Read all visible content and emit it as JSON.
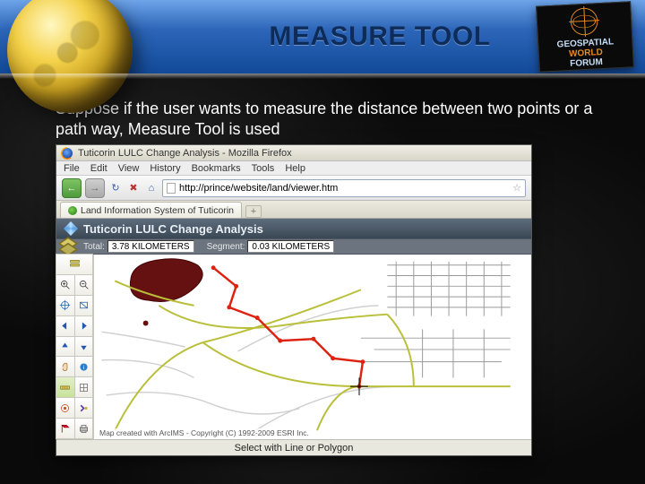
{
  "slide": {
    "title": "MEASURE TOOL",
    "body": "Suppose if the user wants to measure the distance between two points or a path way, Measure Tool is used"
  },
  "forum_badge": {
    "line1": "GEOSPATIAL",
    "line2": "WORLD",
    "line3": "FORUM"
  },
  "browser": {
    "window_title": "Tuticorin LULC Change Analysis - Mozilla Firefox",
    "menus": {
      "file": "File",
      "edit": "Edit",
      "view": "View",
      "history": "History",
      "bookmarks": "Bookmarks",
      "tools": "Tools",
      "help": "Help"
    },
    "address": "http://prince/website/land/viewer.htm",
    "tab_label": "Land Information System of Tuticorin",
    "app_title": "Tuticorin LULC Change Analysis",
    "measure": {
      "total_label": "Total:",
      "total_value": "3.78 KILOMETERS",
      "segment_label": "Segment:",
      "segment_value": "0.03 KILOMETERS"
    },
    "map_credit": "Map created with ArcIMS - Copyright (C) 1992-2009 ESRI Inc.",
    "status_prompt": "Select with Line or Polygon"
  }
}
